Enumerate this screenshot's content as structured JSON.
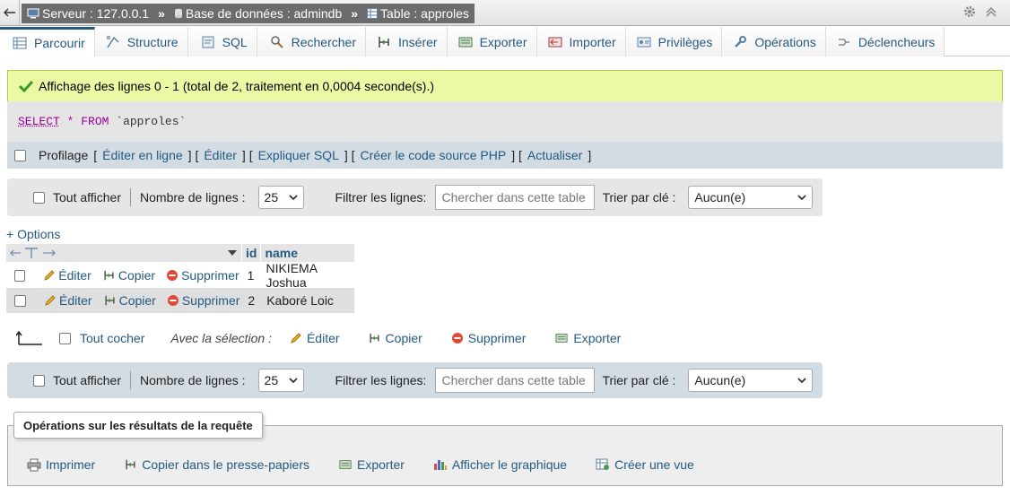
{
  "breadcrumb": {
    "server": "Serveur : 127.0.0.1",
    "database": "Base de données : admindb",
    "table": "Table : approles",
    "separator": "»"
  },
  "tabs": [
    {
      "label": "Parcourir",
      "icon": "browse-icon"
    },
    {
      "label": "Structure",
      "icon": "structure-icon"
    },
    {
      "label": "SQL",
      "icon": "sql-icon"
    },
    {
      "label": "Rechercher",
      "icon": "search-icon"
    },
    {
      "label": "Insérer",
      "icon": "insert-icon"
    },
    {
      "label": "Exporter",
      "icon": "export-icon"
    },
    {
      "label": "Importer",
      "icon": "import-icon"
    },
    {
      "label": "Privilèges",
      "icon": "privileges-icon"
    },
    {
      "label": "Opérations",
      "icon": "wrench-icon"
    },
    {
      "label": "Déclencheurs",
      "icon": "triggers-icon"
    }
  ],
  "message": {
    "success": "Affichage des lignes 0 - 1 (total de 2, traitement en 0,0004 seconde(s).)"
  },
  "sql": {
    "select": "SELECT",
    "star": "*",
    "from": "FROM",
    "table": "`approles`"
  },
  "profiling": {
    "label": "Profilage",
    "links": [
      "Éditer en ligne",
      "Éditer",
      "Expliquer SQL",
      "Créer le code source PHP",
      "Actualiser"
    ]
  },
  "navbar": {
    "show_all": "Tout afficher",
    "rows_label": "Nombre de lignes :",
    "rows_value": "25",
    "filter_label": "Filtrer les lignes:",
    "filter_placeholder": "Chercher dans cette table",
    "sort_label": "Trier par clé :",
    "sort_value": "Aucun(e)"
  },
  "options_link": "+ Options",
  "table": {
    "columns": [
      "id",
      "name"
    ],
    "rows": [
      {
        "id": "1",
        "name": "NIKIEMA Joshua"
      },
      {
        "id": "2",
        "name": "Kaboré Loic"
      }
    ],
    "actions": {
      "edit": "Éditer",
      "copy": "Copier",
      "delete": "Supprimer"
    }
  },
  "bulk": {
    "check_all": "Tout cocher",
    "with_selection": "Avec la sélection :",
    "edit": "Éditer",
    "copy": "Copier",
    "delete": "Supprimer",
    "export": "Exporter"
  },
  "operations": {
    "title": "Opérations sur les résultats de la requête",
    "links": [
      "Imprimer",
      "Copier dans le presse-papiers",
      "Exporter",
      "Afficher le graphique",
      "Créer une vue"
    ]
  },
  "colors": {
    "link": "#235a81",
    "success_bg": "#ebf8a4",
    "navbar_bg": "#d3dce3"
  }
}
